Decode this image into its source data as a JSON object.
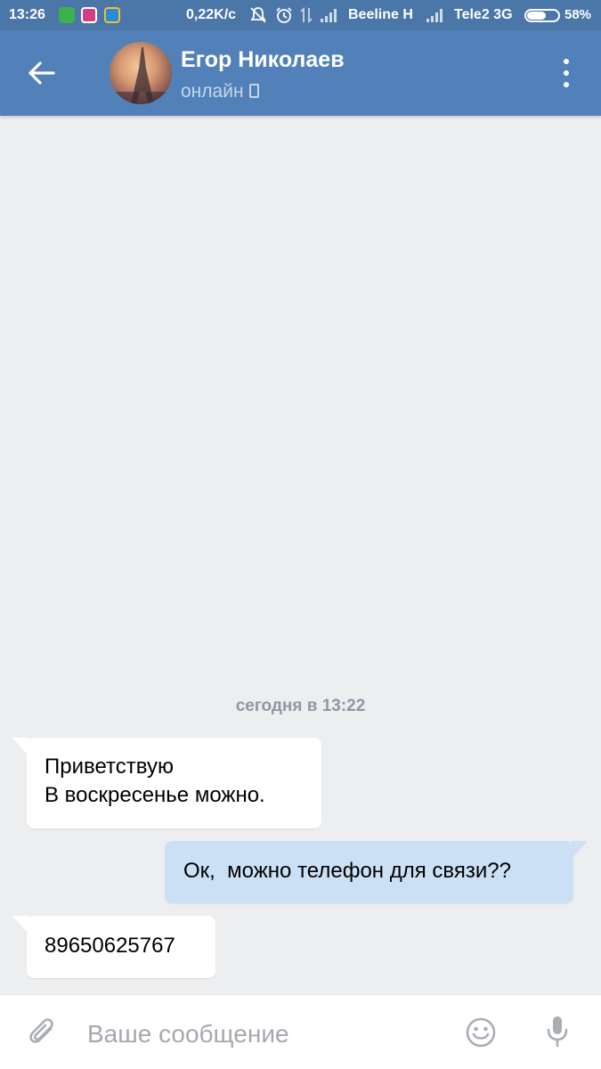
{
  "status_bar": {
    "time": "13:26",
    "speed": "0,22K/c",
    "carrier1": "Beeline H",
    "carrier2": "Tele2 3G",
    "battery": "58%",
    "battery_level": 0.58
  },
  "header": {
    "contact_name": "Егор Николаев",
    "contact_status": "онлайн"
  },
  "chat": {
    "date_separator": "сегодня в 13:22",
    "messages": [
      {
        "direction": "incoming",
        "lines": [
          "Приветствую",
          "В воскресенье можно."
        ]
      },
      {
        "direction": "outgoing",
        "lines": [
          "Ок,  можно телефон для связи??"
        ]
      },
      {
        "direction": "incoming",
        "lines": [
          "89650625767"
        ]
      }
    ]
  },
  "composer": {
    "placeholder": "Ваше сообщение",
    "value": ""
  },
  "colors": {
    "header": "#5181b8",
    "status_bar": "#4a76a8",
    "chat_background": "#edeef0",
    "outgoing_bubble": "#cce0f5",
    "incoming_bubble": "#ffffff"
  },
  "icons": [
    "back-arrow-icon",
    "more-vertical-icon",
    "mobile-phone-icon",
    "paperclip-icon",
    "emoji-icon",
    "microphone-icon"
  ]
}
